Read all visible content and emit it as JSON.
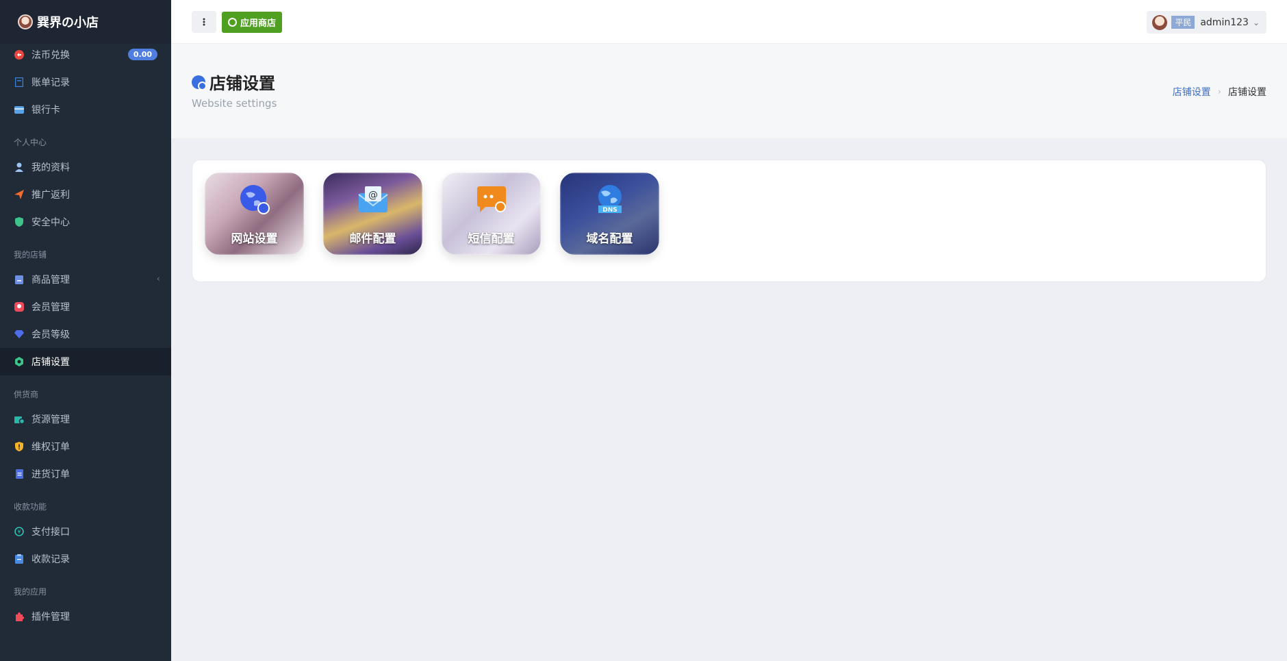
{
  "brand": {
    "name": "巽界の小店"
  },
  "sidebar": {
    "items": [
      {
        "label": "法币兑换",
        "badge": "0.00",
        "icon": "exchange-icon",
        "color": "#e8473f"
      },
      {
        "label": "账单记录",
        "icon": "bill-icon",
        "color": "#3b82d6"
      },
      {
        "label": "银行卡",
        "icon": "card-icon",
        "color": "#5aa2e8"
      }
    ],
    "sections": [
      {
        "title": "个人中心",
        "items": [
          {
            "label": "我的资料",
            "icon": "user-icon",
            "color": "#9cc3f2"
          },
          {
            "label": "推广返利",
            "icon": "send-icon",
            "color": "#f36b2e"
          },
          {
            "label": "安全中心",
            "icon": "shield-icon",
            "color": "#3ec48a"
          }
        ]
      },
      {
        "title": "我的店铺",
        "items": [
          {
            "label": "商品管理",
            "icon": "goods-icon",
            "color": "#6d8fe0"
          },
          {
            "label": "会员管理",
            "icon": "member-icon",
            "color": "#ef4b5a"
          },
          {
            "label": "会员等级",
            "icon": "diamond-icon",
            "color": "#4d6ee8"
          },
          {
            "label": "店铺设置",
            "icon": "shop-settings-icon",
            "color": "#3ec48a"
          }
        ]
      },
      {
        "title": "供货商",
        "items": [
          {
            "label": "货源管理",
            "icon": "supply-icon",
            "color": "#2ab6a8"
          },
          {
            "label": "维权订单",
            "icon": "alert-shield-icon",
            "color": "#f5b325"
          },
          {
            "label": "进货订单",
            "icon": "order-icon",
            "color": "#4a6ee0"
          }
        ]
      },
      {
        "title": "收款功能",
        "items": [
          {
            "label": "支付接口",
            "icon": "payment-icon",
            "color": "#2ec4b6"
          },
          {
            "label": "收款记录",
            "icon": "receipt-icon",
            "color": "#4a8be0"
          }
        ]
      },
      {
        "title": "我的应用",
        "items": [
          {
            "label": "插件管理",
            "icon": "plugin-icon",
            "color": "#ef4b5a"
          }
        ]
      }
    ]
  },
  "header": {
    "menu_icon": "kebab-icon",
    "app_store_label": "应用商店",
    "user": {
      "role": "平民",
      "name": "admin123"
    }
  },
  "page": {
    "title": "店铺设置",
    "subtitle": "Website settings",
    "breadcrumb": {
      "link": "店铺设置",
      "current": "店铺设置"
    }
  },
  "tiles": [
    {
      "label": "网站设置",
      "icon": "globe-gear-icon"
    },
    {
      "label": "邮件配置",
      "icon": "mail-icon"
    },
    {
      "label": "短信配置",
      "icon": "sms-icon"
    },
    {
      "label": "域名配置",
      "icon": "dns-globe-icon"
    }
  ],
  "colors": {
    "sidebar_bg": "#212a37",
    "accent": "#4fa020",
    "link": "#3e6fc4"
  }
}
